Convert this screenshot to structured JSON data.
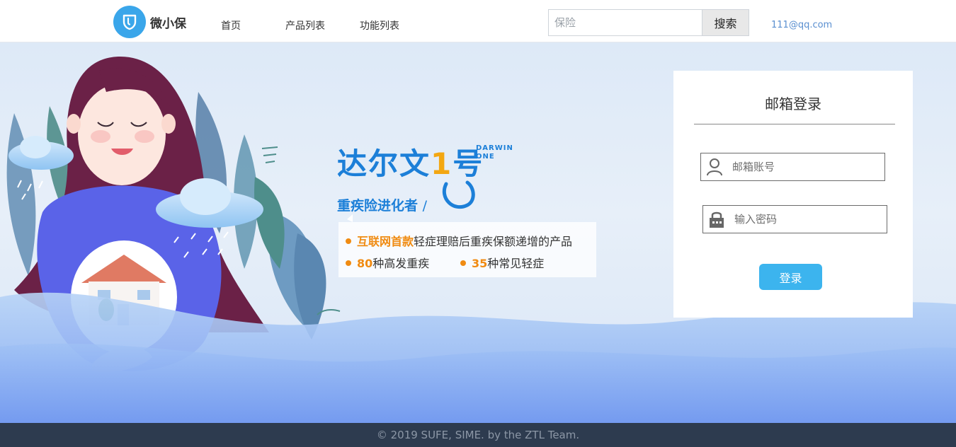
{
  "header": {
    "brand_name": "微小保",
    "nav": [
      "首页",
      "产品列表",
      "功能列表"
    ],
    "search_placeholder": "保险",
    "search_button": "搜索",
    "user_email": "111@qq.com"
  },
  "promo": {
    "title_main": "达尔文",
    "title_number": "1",
    "title_suffix": "号",
    "title_en_line1": "DARWIN",
    "title_en_line2": "ONE",
    "subtitle": "重疾险进化者",
    "features": [
      {
        "highlight": "互联网首款",
        "text": "轻症理赔后重疾保额递增的产品"
      },
      {
        "highlight": "80",
        "text": "种高发重疾"
      },
      {
        "highlight": "35",
        "text": "种常见轻症"
      }
    ]
  },
  "login": {
    "title": "邮箱登录",
    "email_placeholder": "邮箱账号",
    "password_placeholder": "输入密码",
    "submit_label": "登录"
  },
  "footer": {
    "text": "© 2019 SUFE, SIME. by the ZTL Team."
  },
  "colors": {
    "brand_blue": "#3aa6ea",
    "promo_blue": "#1c7fd8",
    "highlight_orange": "#f08b12",
    "button_blue": "#3cb4ee",
    "footer_bg": "#2d3b4f"
  },
  "icons": [
    "shield-logo-icon",
    "user-icon",
    "lock-icon"
  ]
}
